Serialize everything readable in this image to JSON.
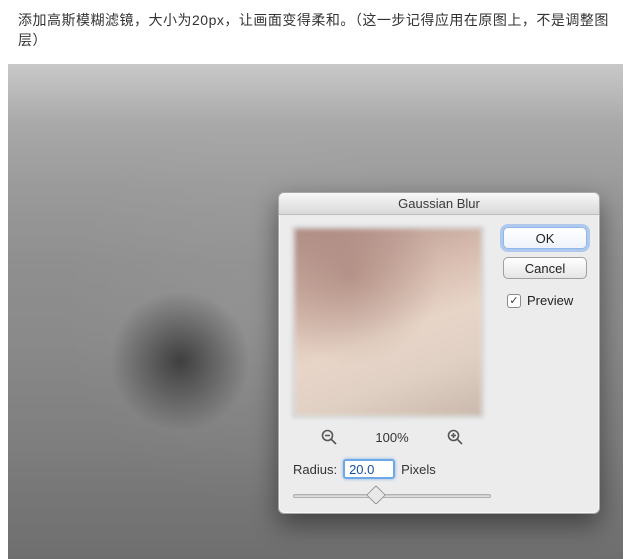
{
  "caption": "添加高斯模糊滤镜，大小为20px，让画面变得柔和。（这一步记得应用在原图上，不是调整图层）",
  "dialog": {
    "title": "Gaussian Blur",
    "ok_label": "OK",
    "cancel_label": "Cancel",
    "preview_label": "Preview",
    "preview_checked": true,
    "zoom_text": "100%",
    "radius_label": "Radius:",
    "radius_value": "20.0",
    "radius_units": "Pixels"
  }
}
